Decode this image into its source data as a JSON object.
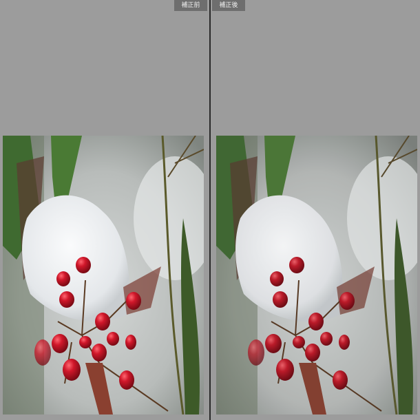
{
  "compare": {
    "before_label": "補正前",
    "after_label": "補正後"
  },
  "photo": {
    "subject": "red-berries-in-snow",
    "colors": {
      "berry": "#d0172a",
      "berry_dark": "#8a0c18",
      "snow": "#eef0f2",
      "leaf": "#3f6a30",
      "stem": "#5a4a2a",
      "background": "#bfc3c2"
    }
  }
}
